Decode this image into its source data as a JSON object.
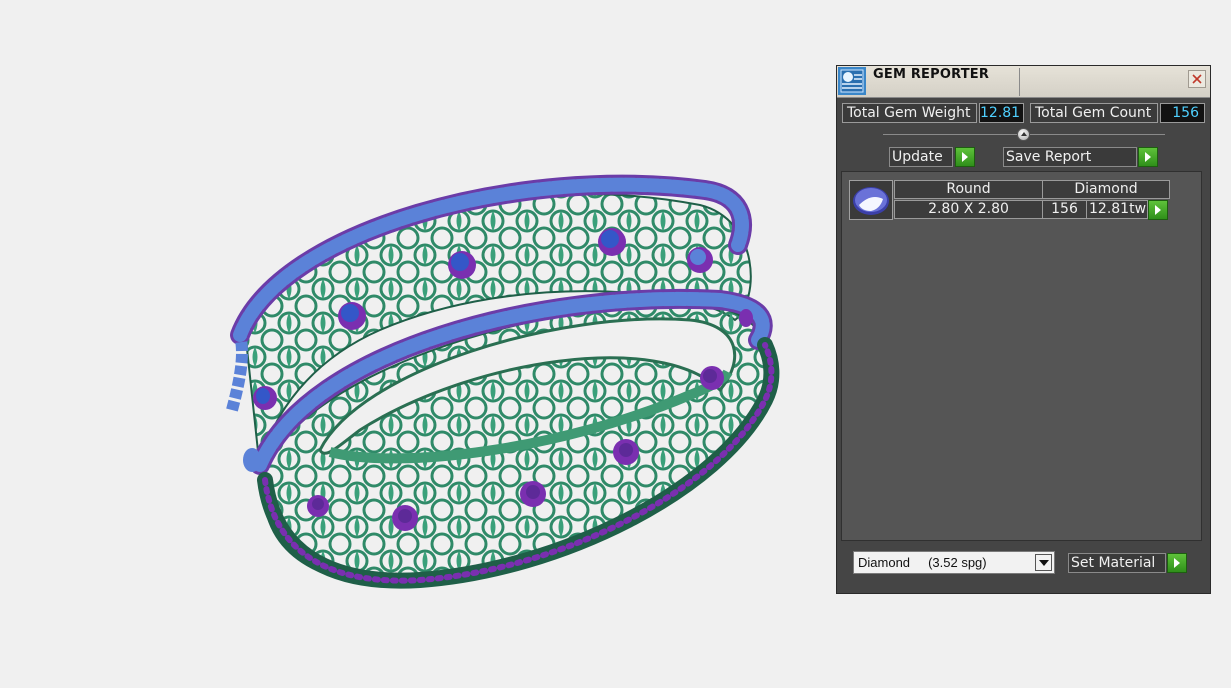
{
  "panel": {
    "title": "GEM REPORTER",
    "icons": {
      "app": "gem-reporter-icon",
      "close": "close-icon",
      "slider": "slider-knob-icon",
      "go": "play-arrow-icon"
    },
    "total_weight_label": "Total Gem Weight",
    "total_weight_value": "12.81",
    "total_count_label": "Total Gem Count",
    "total_count_value": "156",
    "update_label": "Update",
    "save_report_label": "Save Report",
    "gem_row": {
      "shape": "Round",
      "material": "Diamond",
      "size": "2.80 X 2.80",
      "count": "156",
      "weight": "12.81tw"
    },
    "material_select": "Diamond     (3.52 spg)",
    "set_material_label": "Set Material"
  },
  "colors": {
    "panel_bg": "#454545",
    "value_text": "#4fd0ff",
    "go_button": "#3fa52a",
    "metal": "#2f8a68",
    "band_stones": "#5b82d8",
    "prongs": "#7a2fb0"
  }
}
